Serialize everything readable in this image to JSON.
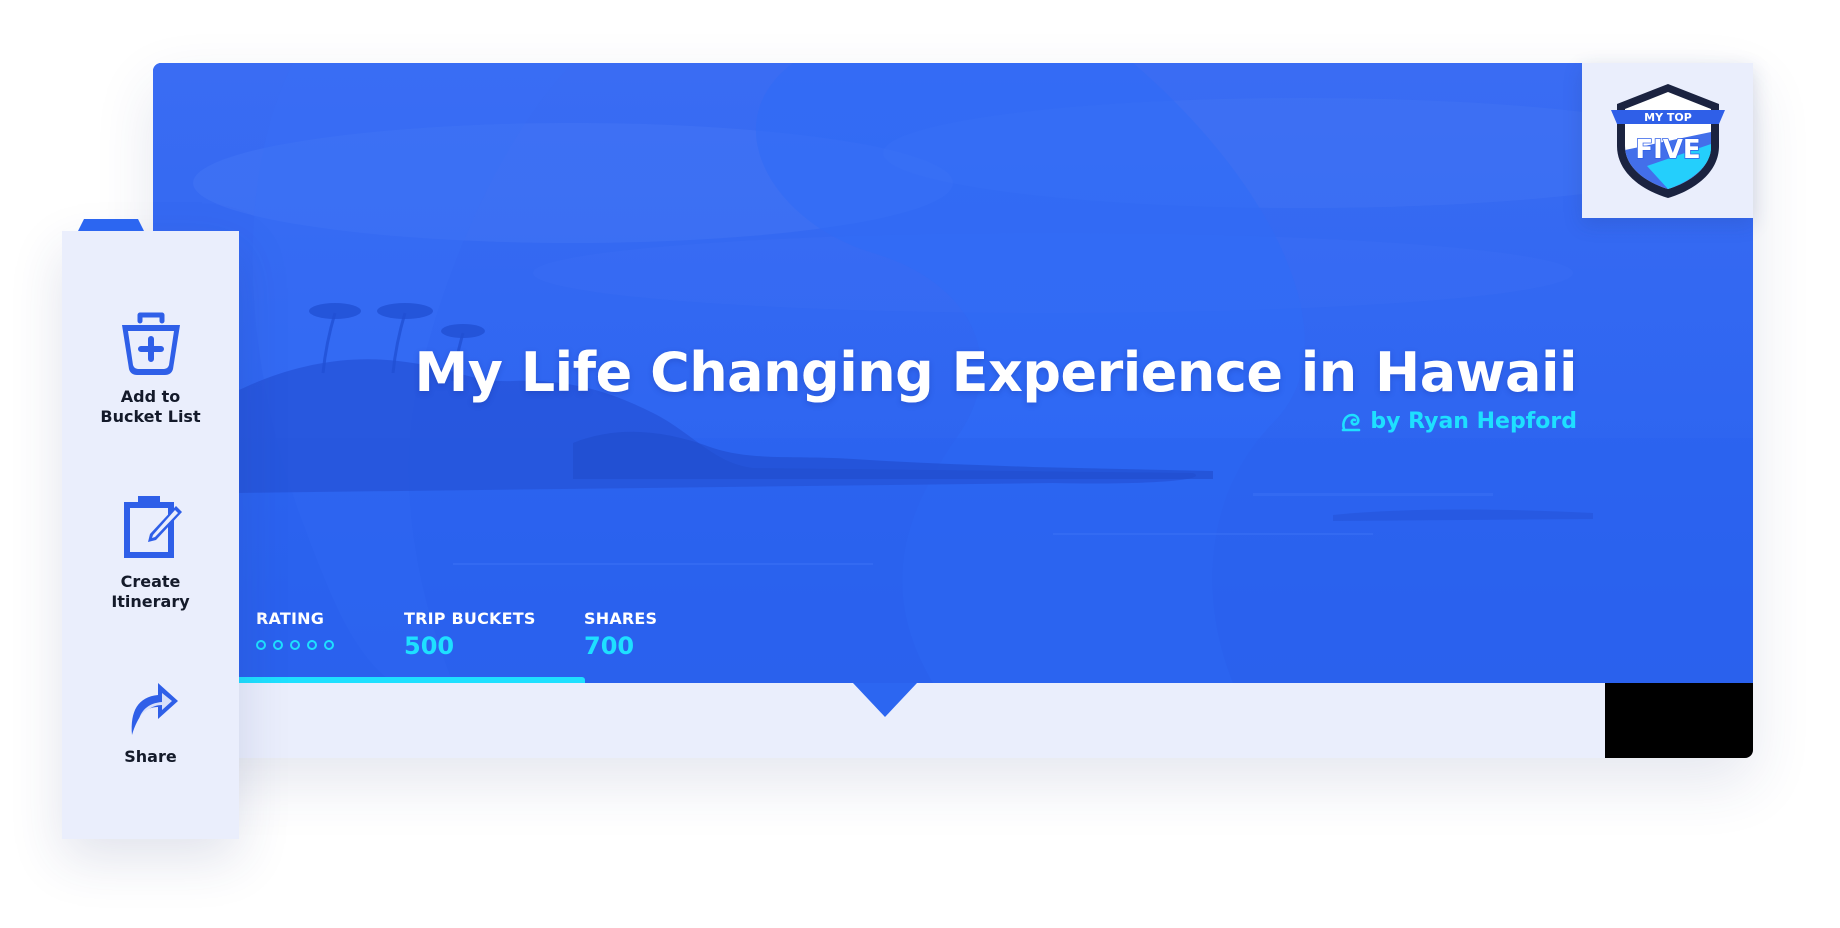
{
  "hero": {
    "title": "My Life Changing Experience in Hawaii",
    "byline": "by Ryan Hepford"
  },
  "stats": {
    "rating": {
      "label": "RATING",
      "value": 0,
      "max": 5
    },
    "trip_buckets": {
      "label": "TRIP BUCKETS",
      "value": "500"
    },
    "shares": {
      "label": "SHARES",
      "value": "700"
    }
  },
  "progress": {
    "fraction": 0.27
  },
  "badge": {
    "line1": "MY TOP",
    "line2": "FIVE"
  },
  "actions": [
    {
      "label": "Add to Bucket List",
      "icon": "bucket-add-icon"
    },
    {
      "label": "Create Itinerary",
      "icon": "clipboard-edit-icon"
    },
    {
      "label": "Share",
      "icon": "share-arrow-icon"
    }
  ],
  "colors": {
    "hero_blue": "#2c66f1",
    "accent_cyan": "#1ee0ff",
    "panel_bg": "#eaeefc",
    "icon_blue": "#2f5fe8",
    "text_dark": "#141a2a"
  }
}
